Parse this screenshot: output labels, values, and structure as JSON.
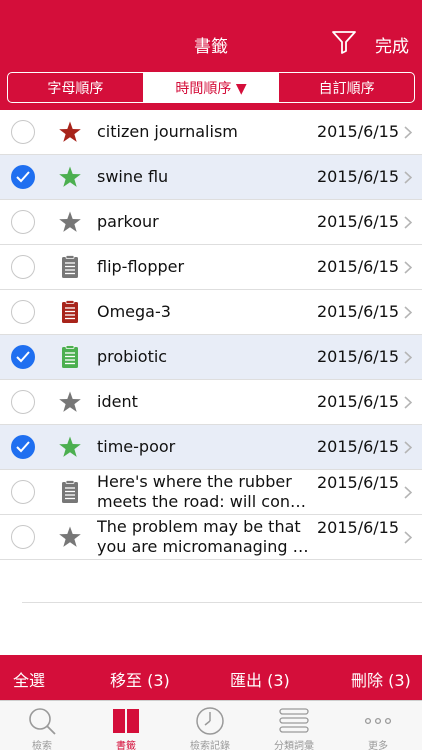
{
  "header": {
    "title": "書籤",
    "done_label": "完成",
    "accent_color": "#d40e3a",
    "icons": [
      "filter-icon"
    ]
  },
  "sort_tabs": [
    {
      "label": "字母順序",
      "active": false
    },
    {
      "label": "時間順序 ▼",
      "active": true
    },
    {
      "label": "自訂順序",
      "active": false
    }
  ],
  "entries": [
    {
      "text": "citizen journalism",
      "date": "2015/6/15",
      "icon": "star",
      "color": "#a8241b",
      "checked": false
    },
    {
      "text": "swine flu",
      "date": "2015/6/15",
      "icon": "star",
      "color": "#4caf50",
      "checked": true
    },
    {
      "text": "parkour",
      "date": "2015/6/15",
      "icon": "star",
      "color": "#777777",
      "checked": false
    },
    {
      "text": "flip-flopper",
      "date": "2015/6/15",
      "icon": "note",
      "color": "#777777",
      "checked": false
    },
    {
      "text": "Omega-3",
      "date": "2015/6/15",
      "icon": "note",
      "color": "#a8241b",
      "checked": false
    },
    {
      "text": "probiotic",
      "date": "2015/6/15",
      "icon": "note",
      "color": "#4caf50",
      "checked": true
    },
    {
      "text": "ident",
      "date": "2015/6/15",
      "icon": "star",
      "color": "#777777",
      "checked": false
    },
    {
      "text": "time-poor",
      "date": "2015/6/15",
      "icon": "star",
      "color": "#4caf50",
      "checked": true
    },
    {
      "text_lines": [
        "Here's where the rubber",
        "meets the road: will cons…"
      ],
      "date": "2015/6/15",
      "icon": "note",
      "color": "#777777",
      "checked": false
    },
    {
      "text_lines": [
        "The problem may be that",
        "you are micromanaging y…"
      ],
      "date": "2015/6/15",
      "icon": "star",
      "color": "#777777",
      "checked": false
    }
  ],
  "actions": {
    "select_all": "全選",
    "move": "移至 (3)",
    "export": "匯出 (3)",
    "delete": "刪除 (3)"
  },
  "tabs": [
    {
      "label": "檢索",
      "icon": "search-icon",
      "active": false
    },
    {
      "label": "書籤",
      "icon": "bookmark-icon",
      "active": true
    },
    {
      "label": "檢索記錄",
      "icon": "clock-icon",
      "active": false
    },
    {
      "label": "分類詞彙",
      "icon": "list-icon",
      "active": false
    },
    {
      "label": "更多",
      "icon": "more-icon",
      "active": false
    }
  ]
}
